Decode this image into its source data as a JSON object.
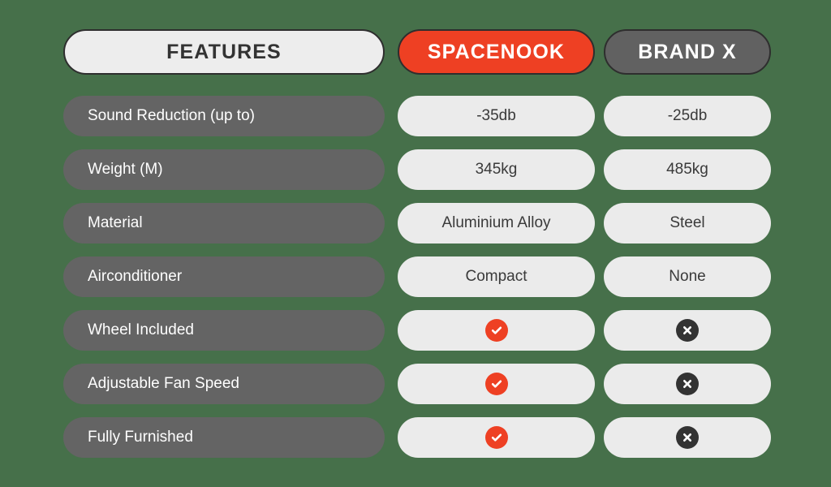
{
  "theme": {
    "background": "#46704a",
    "accent_red": "#ee4023",
    "neutral_gray": "#646464",
    "header_gray": "#616161",
    "cell_light": "#ebebeb",
    "text_dark": "#333333"
  },
  "header": {
    "features_label": "FEATURES",
    "spacenook_label": "SPACENOOK",
    "brandx_label": "BRAND X"
  },
  "comparison": {
    "columns": [
      "FEATURES",
      "SPACENOOK",
      "BRAND X"
    ],
    "rows": [
      {
        "feature": "Sound Reduction (up to)",
        "spacenook": "-35db",
        "brandx": "-25db",
        "spacenook_type": "text",
        "brandx_type": "text"
      },
      {
        "feature": "Weight (M)",
        "spacenook": "345kg",
        "brandx": "485kg",
        "spacenook_type": "text",
        "brandx_type": "text"
      },
      {
        "feature": "Material",
        "spacenook": "Aluminium Alloy",
        "brandx": "Steel",
        "spacenook_type": "text",
        "brandx_type": "text"
      },
      {
        "feature": "Airconditioner",
        "spacenook": "Compact",
        "brandx": "None",
        "spacenook_type": "text",
        "brandx_type": "text"
      },
      {
        "feature": "Wheel Included",
        "spacenook": "check",
        "brandx": "cross",
        "spacenook_type": "icon",
        "brandx_type": "icon"
      },
      {
        "feature": "Adjustable Fan Speed",
        "spacenook": "check",
        "brandx": "cross",
        "spacenook_type": "icon",
        "brandx_type": "icon"
      },
      {
        "feature": "Fully Furnished",
        "spacenook": "check",
        "brandx": "cross",
        "spacenook_type": "icon",
        "brandx_type": "icon"
      }
    ]
  },
  "icons": {
    "check": "check-circle-icon",
    "cross": "cross-circle-icon"
  }
}
